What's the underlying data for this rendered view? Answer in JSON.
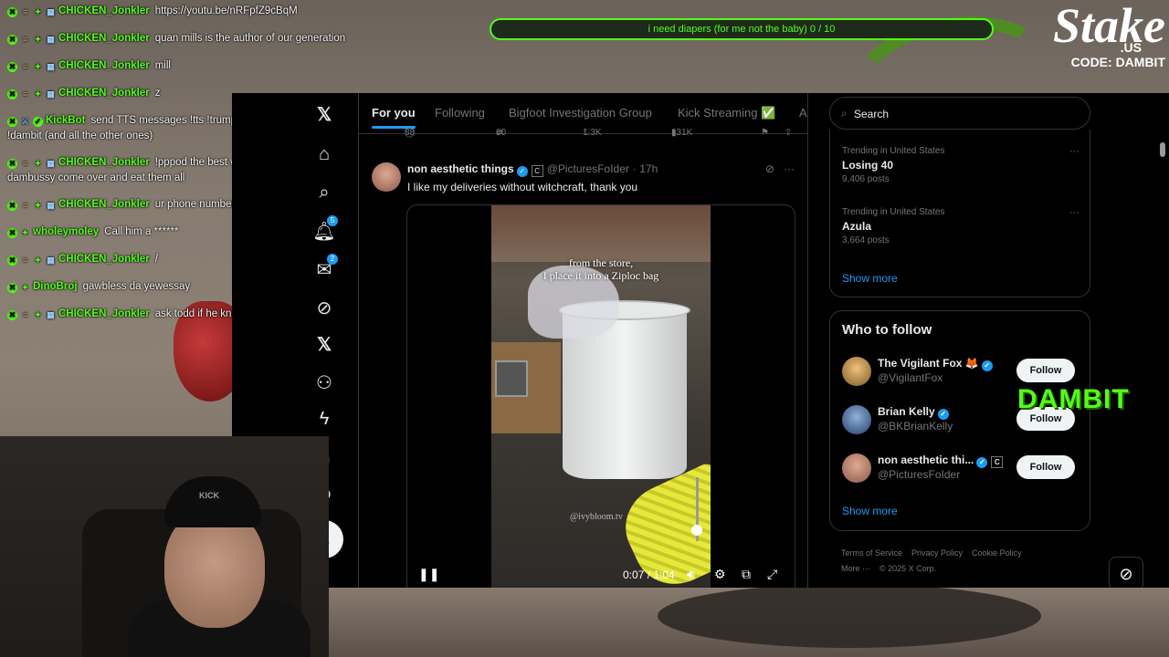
{
  "stream": {
    "goal": "i need diapers (for me not the baby) 0 / 10",
    "sponsor_logo": "Stake",
    "sponsor_region": ".US",
    "sponsor_code": "CODE: DAMBIT",
    "channel_overlay": "DAMBIT"
  },
  "chat": [
    {
      "user": "CHICKEN_Jonkler",
      "text": "https://youtu.be/nRFpfZ9cBqM"
    },
    {
      "user": "CHICKEN_Jonkler",
      "text": "quan mills is the author of our generation"
    },
    {
      "user": "CHICKEN_Jonkler",
      "text": "mill"
    },
    {
      "user": "CHICKEN_Jonkler",
      "text": "z"
    },
    {
      "user": "KickBot",
      "text": "send TTS messages !tts !trump !alex !ralph !njf !tucker !teddy !bean !dambit (and all the other ones)"
    },
    {
      "user": "CHICKEN_Jonkler",
      "text": "!pppod the best way to get rid of roaches is to have dambussy come over and eat them all"
    },
    {
      "user": "CHICKEN_Jonkler",
      "text": "ur phone number"
    },
    {
      "user": "wholeymoley",
      "text": "Call him a ******"
    },
    {
      "user": "CHICKEN_Jonkler",
      "text": "/"
    },
    {
      "user": "DinoBroj",
      "text": "gawbless da yewessay"
    },
    {
      "user": "CHICKEN_Jonkler",
      "text": "ask todd if he knows about quan millz"
    }
  ],
  "x": {
    "tabs": [
      {
        "label": "For you"
      },
      {
        "label": "Following"
      },
      {
        "label": "Bigfoot Investigation Group"
      },
      {
        "label": "Kick Streaming ✅"
      },
      {
        "label": "A"
      }
    ],
    "nav_badges": {
      "notifications": "5",
      "messages": "2"
    },
    "prev_actions": {
      "replies": "88",
      "reposts": "60",
      "likes": "1.3K",
      "views": "131K"
    },
    "tweet": {
      "name": "non aesthetic things",
      "handle": "@PicturesFoIder",
      "time": "· 17h",
      "text": "I like my deliveries without witchcraft, thank you",
      "video_caption_1": "from the store,",
      "video_caption_2": "I place it into a Ziploc bag",
      "video_watermark": "@ivybloom.tv",
      "video_time": "0:07 / 1:04"
    },
    "search_placeholder": "Search",
    "trends": [
      {
        "context": "Trending in United States",
        "title": "Losing 40",
        "posts": "9,406 posts"
      },
      {
        "context": "Trending in United States",
        "title": "Azula",
        "posts": "3,664 posts"
      }
    ],
    "show_more": "Show more",
    "who_to_follow": {
      "title": "Who to follow",
      "accounts": [
        {
          "name": "The Vigilant Fox 🦊",
          "handle": "@VigilantFox",
          "button": "Follow"
        },
        {
          "name": "Brian Kelly",
          "handle": "@BKBrianKelly",
          "button": "Follow"
        },
        {
          "name": "non aesthetic thi...",
          "handle": "@PicturesFoIder",
          "button": "Follow"
        }
      ],
      "show_more": "Show more"
    },
    "footer": {
      "terms": "Terms of Service",
      "privacy": "Privacy Policy",
      "cookie": "Cookie Policy",
      "more": "More ···",
      "copyright": "© 2025 X Corp."
    }
  },
  "webcam": {
    "cap_text": "KICK"
  },
  "colors": {
    "kick_green": "#53fc18",
    "x_blue": "#1d9bf0",
    "x_bg": "#000000"
  }
}
